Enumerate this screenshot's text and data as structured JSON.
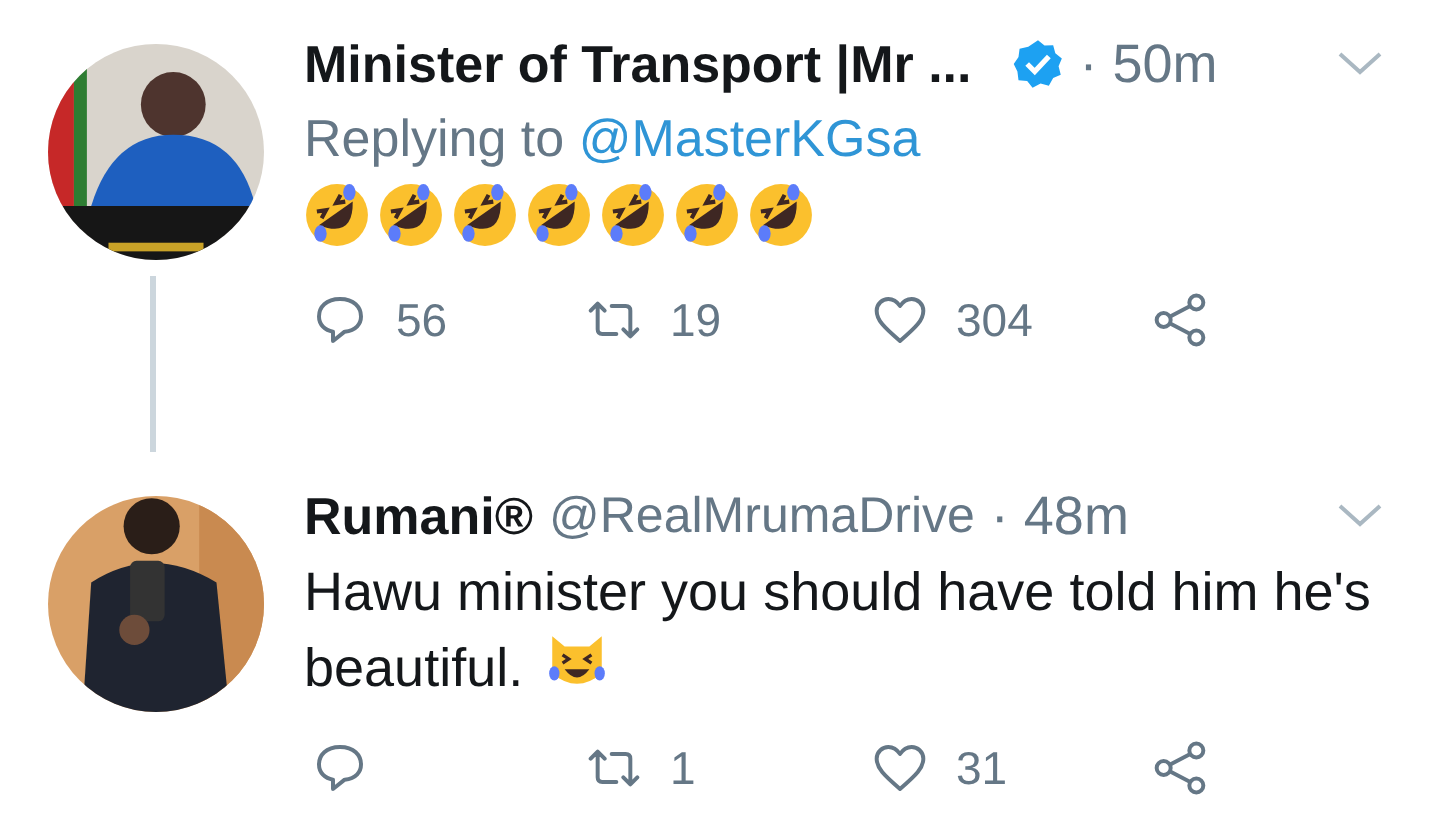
{
  "tweets": [
    {
      "name": "Minister of Transport |Mr ...",
      "verified": true,
      "time": "· 50m",
      "thread_line": true,
      "replying_to": {
        "prefix": "Replying to",
        "handle": "@MasterKGsa"
      },
      "emojis": [
        {
          "kind": "rofl"
        },
        {
          "kind": "rofl"
        },
        {
          "kind": "rofl"
        },
        {
          "kind": "rofl"
        },
        {
          "kind": "rofl"
        },
        {
          "kind": "rofl"
        },
        {
          "kind": "rofl"
        }
      ],
      "actions": [
        {
          "kind": "reply",
          "count": "56"
        },
        {
          "kind": "retweet",
          "count": "19"
        },
        {
          "kind": "like",
          "count": "304"
        },
        {
          "kind": "share"
        }
      ]
    },
    {
      "name": "Rumani®",
      "handle": "@RealMrumaDrive",
      "verified": false,
      "time": "· 48m",
      "thread_line": false,
      "text": "Hawu minister you should have told him he's beautiful.",
      "emojis": [
        {
          "kind": "cat_joy"
        }
      ],
      "actions": [
        {
          "kind": "reply"
        },
        {
          "kind": "retweet",
          "count": "1"
        },
        {
          "kind": "like",
          "count": "31"
        },
        {
          "kind": "share"
        }
      ]
    }
  ]
}
